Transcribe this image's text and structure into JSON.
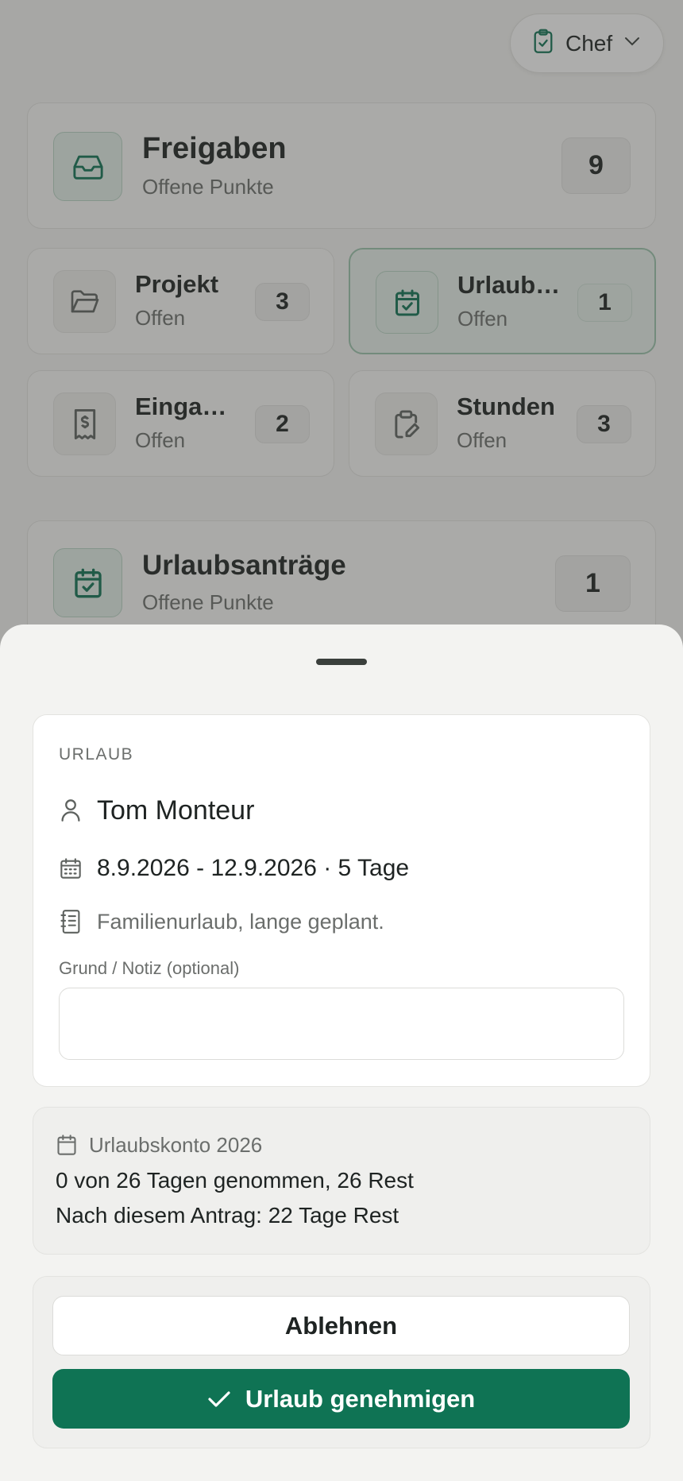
{
  "colors": {
    "accent": "#0f7354",
    "muted_text": "#6b6e6c"
  },
  "header": {
    "role_label": "Chef",
    "role_icon": "clipboard-check-icon"
  },
  "summary": {
    "title": "Freigaben",
    "subtitle": "Offene Punkte",
    "count": "9",
    "icon": "inbox-icon"
  },
  "tiles": [
    {
      "title": "Projekt",
      "subtitle": "Offen",
      "count": "3",
      "icon": "folder-icon"
    },
    {
      "title": "Urlaub…",
      "subtitle": "Offen",
      "count": "1",
      "icon": "calendar-check-icon"
    },
    {
      "title": "Eingan…",
      "subtitle": "Offen",
      "count": "2",
      "icon": "receipt-icon"
    },
    {
      "title": "Stunden",
      "subtitle": "Offen",
      "count": "3",
      "icon": "clipboard-edit-icon"
    }
  ],
  "section": {
    "title": "Urlaubsanträge",
    "subtitle": "Offene Punkte",
    "count": "1",
    "icon": "calendar-check-icon"
  },
  "sheet": {
    "eyebrow": "URLAUB",
    "employee": "Tom Monteur",
    "dates": "8.9.2026 - 12.9.2026 · 5 Tage",
    "reason": "Familienurlaub, lange geplant.",
    "note_label": "Grund / Notiz (optional)",
    "note_value": "",
    "balance": {
      "title": "Urlaubskonto 2026",
      "line1": "0 von 26 Tagen genommen, 26 Rest",
      "line2": "Nach diesem Antrag: 22 Tage Rest"
    },
    "reject_label": "Ablehnen",
    "approve_label": "Urlaub genehmigen"
  }
}
